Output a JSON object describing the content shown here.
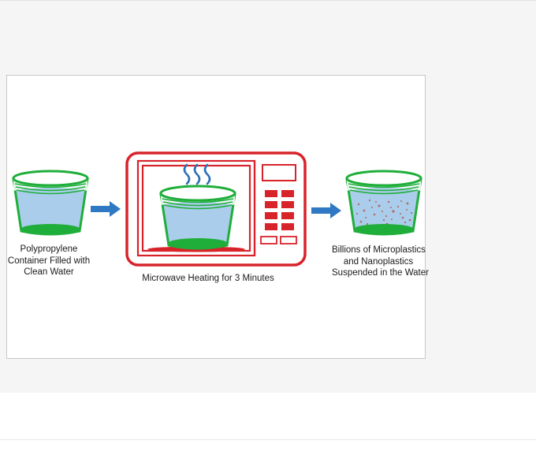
{
  "figure": {
    "caption_left": [
      "Polypropylene",
      "Container Filled with",
      "Clean Water"
    ],
    "caption_middle": "Microwave Heating for 3 Minutes",
    "caption_right": [
      "Billions of Microplastics",
      "and Nanoplastics",
      "Suspended in the Water"
    ]
  },
  "colors": {
    "container_green": "#1fae3a",
    "water_blue": "#a9cdea",
    "microwave_red": "#d8232a",
    "arrow_blue": "#2f78c4",
    "steam_blue": "#2f6fb8",
    "particle_red": "#b84a3a"
  }
}
